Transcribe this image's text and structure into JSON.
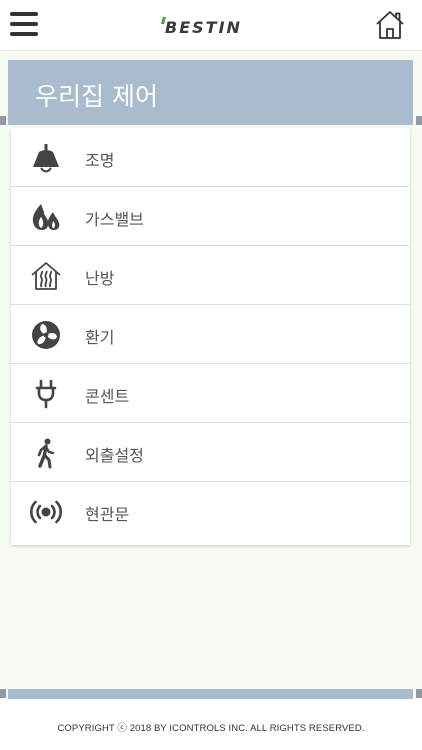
{
  "header": {
    "brand": "BESTIN",
    "menu_icon": "hamburger-menu-icon",
    "home_icon": "home-icon"
  },
  "section": {
    "title": "우리집 제어"
  },
  "menu": {
    "items": [
      {
        "label": "조명",
        "icon": "lamp-icon"
      },
      {
        "label": "가스밸브",
        "icon": "flame-icon"
      },
      {
        "label": "난방",
        "icon": "heating-icon"
      },
      {
        "label": "환기",
        "icon": "fan-icon"
      },
      {
        "label": "콘센트",
        "icon": "plug-icon"
      },
      {
        "label": "외출설정",
        "icon": "walking-person-icon"
      },
      {
        "label": "현관문",
        "icon": "broadcast-icon"
      }
    ]
  },
  "footer": {
    "copyright": "COPYRIGHT ⓒ 2018 BY ICONTROLS INC. ALL RIGHTS RESERVED."
  },
  "colors": {
    "accent": "#a8bccd",
    "brand_green": "#3aa935",
    "background": "#f6fbf3"
  }
}
